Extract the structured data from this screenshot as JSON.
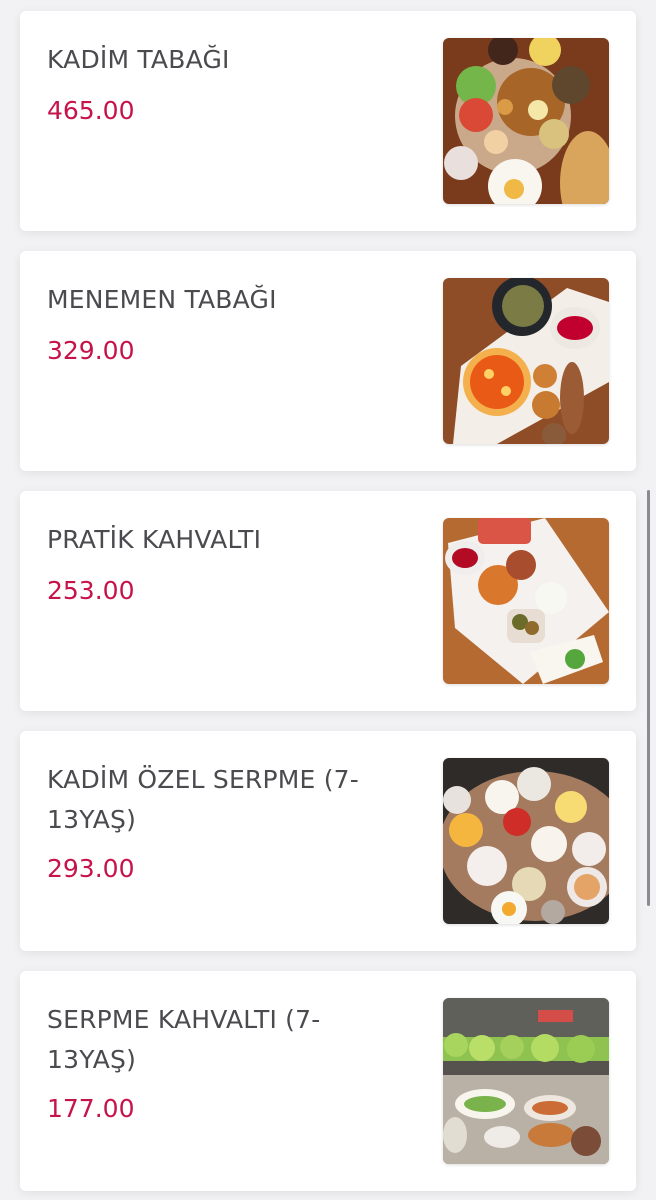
{
  "menu": {
    "items": [
      {
        "title": "KADİM TABAĞI",
        "price": "465.00"
      },
      {
        "title": "MENEMEN TABAĞI",
        "price": "329.00"
      },
      {
        "title": "PRATİK KAHVALTI",
        "price": "253.00"
      },
      {
        "title": "KADİM ÖZEL SERPME (7-13YAŞ)",
        "price": "293.00"
      },
      {
        "title": "SERPME KAHVALTI (7-13YAŞ)",
        "price": "177.00"
      }
    ]
  },
  "theme": {
    "title_color": "#4a4a4f",
    "price_color": "#c6144b",
    "background": "#f2f2f4"
  }
}
